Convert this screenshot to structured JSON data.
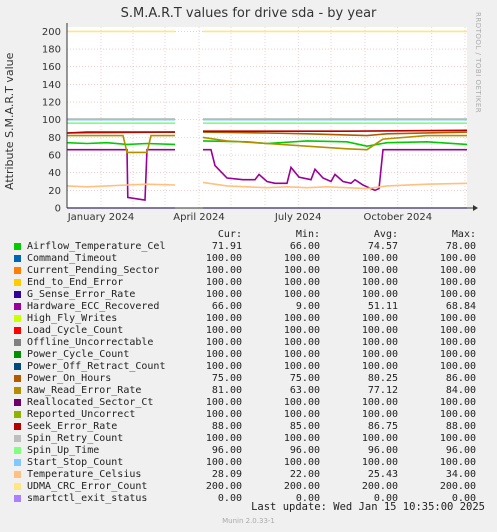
{
  "chart_data": {
    "type": "line",
    "title": "S.M.A.R.T values for drive sda - by year",
    "ylabel": "Attribute S.M.A.R.T value",
    "xlabel": "",
    "x_tick_labels": [
      "January 2024",
      "April 2024",
      "July 2024",
      "October 2024"
    ],
    "y_ticks": [
      0,
      20,
      40,
      60,
      80,
      100,
      120,
      140,
      160,
      180,
      200
    ],
    "ylim": [
      0,
      205
    ],
    "grid": true,
    "legend_placement": "bottom",
    "legend_headers": {
      "cur": "Cur:",
      "min": "Min:",
      "avg": "Avg:",
      "max": "Max:"
    },
    "series": [
      {
        "name": "Airflow_Temperature_Cel",
        "color": "#00cc00",
        "cur": "71.91",
        "min": "66.00",
        "avg": "74.57",
        "max": "78.00"
      },
      {
        "name": "Command_Timeout",
        "color": "#0066b3",
        "cur": "100.00",
        "min": "100.00",
        "avg": "100.00",
        "max": "100.00"
      },
      {
        "name": "Current_Pending_Sector",
        "color": "#ff8000",
        "cur": "100.00",
        "min": "100.00",
        "avg": "100.00",
        "max": "100.00"
      },
      {
        "name": "End_to_End_Error",
        "color": "#ffcc00",
        "cur": "100.00",
        "min": "100.00",
        "avg": "100.00",
        "max": "100.00"
      },
      {
        "name": "G_Sense_Error_Rate",
        "color": "#330099",
        "cur": "100.00",
        "min": "100.00",
        "avg": "100.00",
        "max": "100.00"
      },
      {
        "name": "Hardware_ECC_Recovered",
        "color": "#990099",
        "cur": "66.00",
        "min": "9.00",
        "avg": "51.11",
        "max": "68.84"
      },
      {
        "name": "High_Fly_Writes",
        "color": "#ccff00",
        "cur": "100.00",
        "min": "100.00",
        "avg": "100.00",
        "max": "100.00"
      },
      {
        "name": "Load_Cycle_Count",
        "color": "#ff0000",
        "cur": "100.00",
        "min": "100.00",
        "avg": "100.00",
        "max": "100.00"
      },
      {
        "name": "Offline_Uncorrectable",
        "color": "#808080",
        "cur": "100.00",
        "min": "100.00",
        "avg": "100.00",
        "max": "100.00"
      },
      {
        "name": "Power_Cycle_Count",
        "color": "#008f00",
        "cur": "100.00",
        "min": "100.00",
        "avg": "100.00",
        "max": "100.00"
      },
      {
        "name": "Power_Off_Retract_Count",
        "color": "#00487d",
        "cur": "100.00",
        "min": "100.00",
        "avg": "100.00",
        "max": "100.00"
      },
      {
        "name": "Power_On_Hours",
        "color": "#b35a00",
        "cur": "75.00",
        "min": "75.00",
        "avg": "80.25",
        "max": "86.00"
      },
      {
        "name": "Raw_Read_Error_Rate",
        "color": "#b38f00",
        "cur": "81.00",
        "min": "63.00",
        "avg": "77.12",
        "max": "84.00"
      },
      {
        "name": "Reallocated_Sector_Ct",
        "color": "#6b006b",
        "cur": "100.00",
        "min": "100.00",
        "avg": "100.00",
        "max": "100.00"
      },
      {
        "name": "Reported_Uncorrect",
        "color": "#8fb300",
        "cur": "100.00",
        "min": "100.00",
        "avg": "100.00",
        "max": "100.00"
      },
      {
        "name": "Seek_Error_Rate",
        "color": "#b30000",
        "cur": "88.00",
        "min": "85.00",
        "avg": "86.75",
        "max": "88.00"
      },
      {
        "name": "Spin_Retry_Count",
        "color": "#bebebe",
        "cur": "100.00",
        "min": "100.00",
        "avg": "100.00",
        "max": "100.00"
      },
      {
        "name": "Spin_Up_Time",
        "color": "#80ff80",
        "cur": "96.00",
        "min": "96.00",
        "avg": "96.00",
        "max": "96.00"
      },
      {
        "name": "Start_Stop_Count",
        "color": "#80c9ff",
        "cur": "100.00",
        "min": "100.00",
        "avg": "100.00",
        "max": "100.00"
      },
      {
        "name": "Temperature_Celsius",
        "color": "#ffc080",
        "cur": "28.09",
        "min": "22.00",
        "avg": "25.43",
        "max": "34.00"
      },
      {
        "name": "UDMA_CRC_Error_Count",
        "color": "#ffe680",
        "cur": "200.00",
        "min": "200.00",
        "avg": "200.00",
        "max": "200.00"
      },
      {
        "name": "smartctl_exit_status",
        "color": "#aa80ff",
        "cur": "0.00",
        "min": "0.00",
        "avg": "0.00",
        "max": "0.00"
      }
    ]
  },
  "sidebar_text": "RRDTOOL / TOBI OETIKER",
  "footer": {
    "last_update": "Last update:  Wed Jan 15 10:35:00 2025",
    "version": "Munin 2.0.33-1"
  }
}
